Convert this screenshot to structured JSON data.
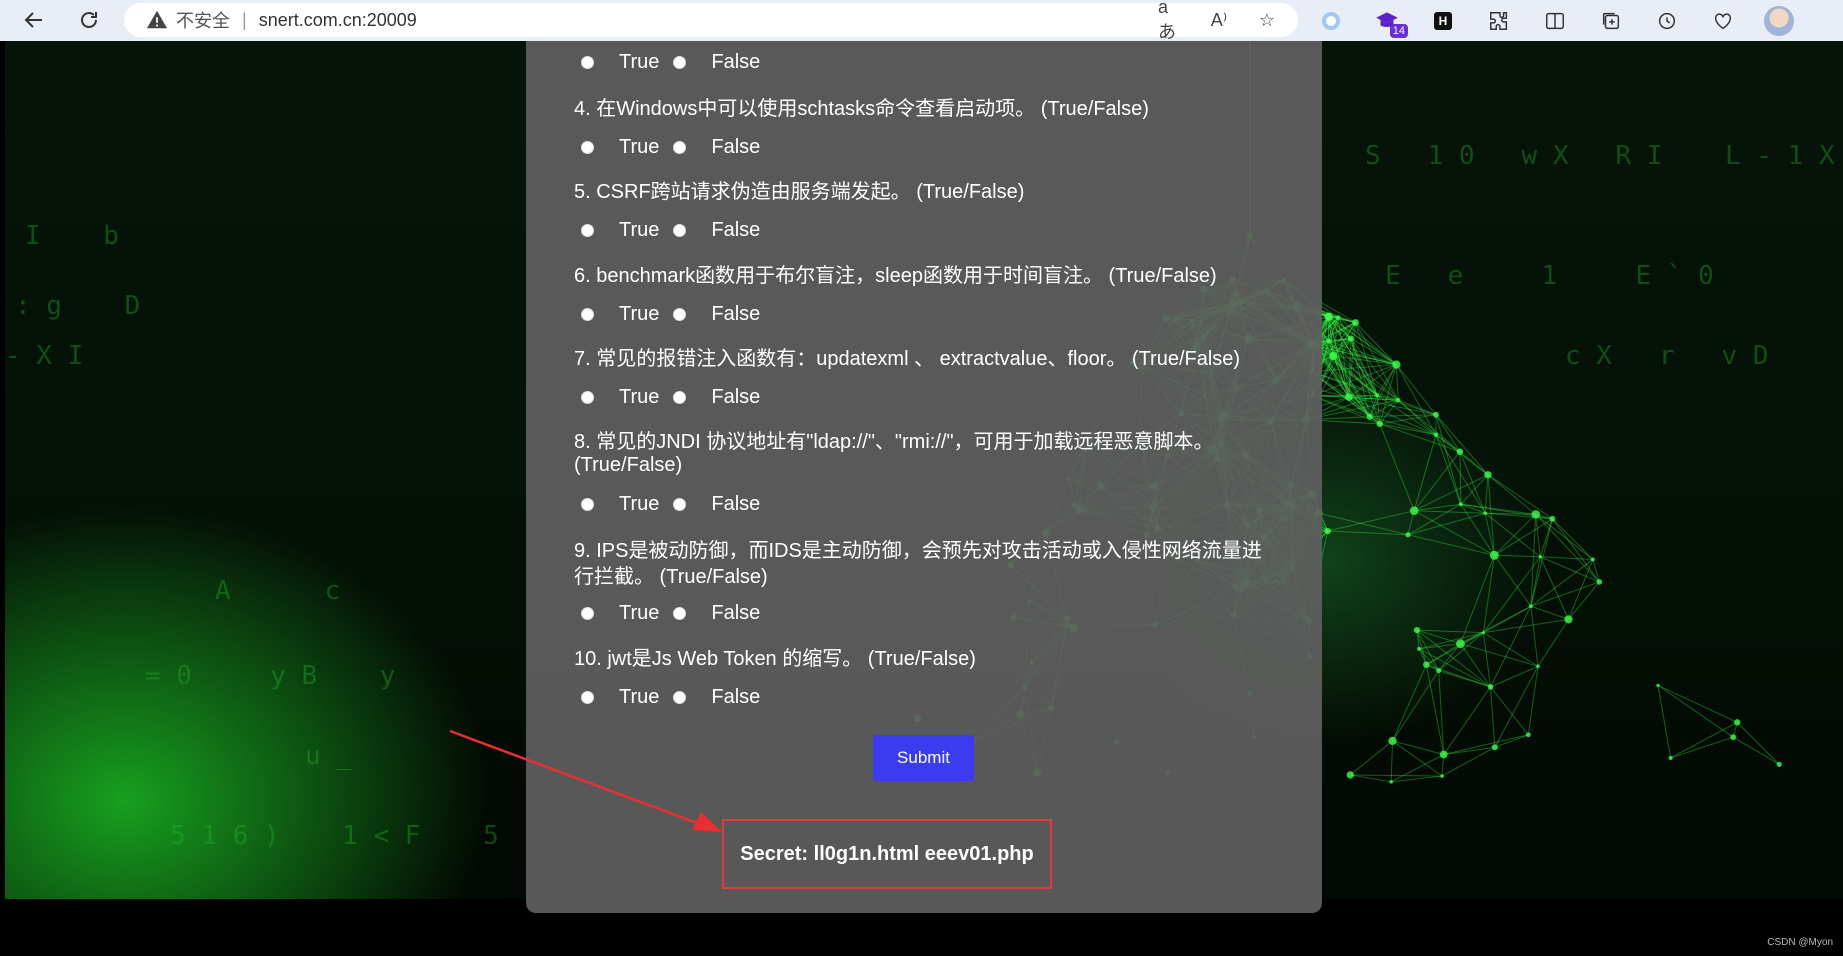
{
  "browser": {
    "security_label": "不安全",
    "url": "snert.com.cn:20009",
    "extension_badge": "14",
    "h_icon_label": "H"
  },
  "quiz": {
    "answer_true": "True",
    "answer_false": "False",
    "questions": [
      {
        "text": "4. 在Windows中可以使用schtasks命令查看启动项。 (True/False)"
      },
      {
        "text": "5. CSRF跨站请求伪造由服务端发起。 (True/False)"
      },
      {
        "text": "6. benchmark函数用于布尔盲注，sleep函数用于时间盲注。 (True/False)"
      },
      {
        "text": "7. 常见的报错注入函数有：updatexml 、 extractvalue、floor。 (True/False)"
      },
      {
        "text": "8. 常见的JNDI 协议地址有\"ldap://\"、\"rmi://\"，可用于加载远程恶意脚本。 (True/False)"
      },
      {
        "text": "9. IPS是被动防御，而IDS是主动防御，会预先对攻击活动或入侵性网络流量进行拦截。 (True/False)"
      },
      {
        "text": "10. jwt是Js Web Token 的缩写。 (True/False)"
      }
    ],
    "submit_label": "Submit",
    "secret_text": "Secret: ll0g1n.html eeev01.php"
  },
  "watermark": "CSDN @Myon⁠",
  "colors": {
    "submit_bg": "#3b3bf0",
    "highlight_border": "#e23b3b",
    "panel_bg": "#5f5f5f",
    "network_green": "#3cff4a"
  }
}
